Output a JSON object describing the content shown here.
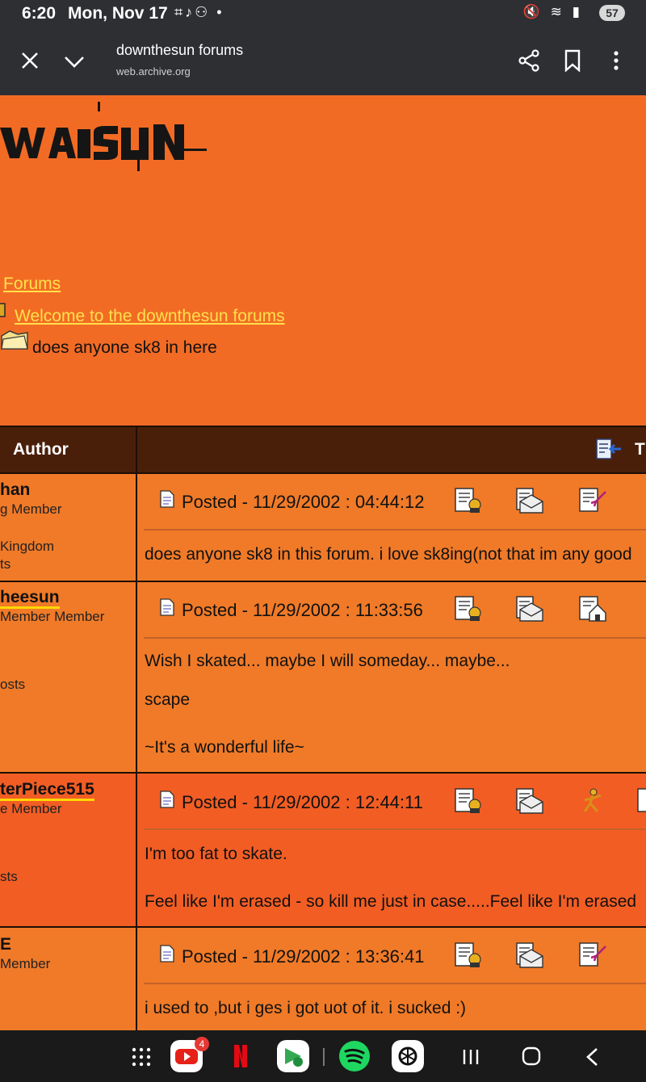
{
  "status_bar": {
    "time": "6:20",
    "date": "Mon, Nov 17",
    "left_icons": "⌗♪⚇ •",
    "right_icons": "🔇 ≋ ▮",
    "battery": "57"
  },
  "toolbar": {
    "page_title": "downthesun forums",
    "url": "web.archive.org"
  },
  "breadcrumbs": {
    "root": "Forums",
    "forum": "Welcome to the downthesun forums",
    "topic": "does anyone sk8 in here"
  },
  "table": {
    "author_header": "Author",
    "topic_header_char": "T"
  },
  "posts": [
    {
      "author": "han",
      "rank": "g Member",
      "location": "Kingdom",
      "posts": "ts",
      "posted": "Posted - 11/29/2002 :  04:44:12",
      "message": "does anyone sk8 in this forum. i love sk8ing(not that im any good"
    },
    {
      "author": "heesun",
      "rank": "Member Member",
      "posts": "osts",
      "posted": "Posted - 11/29/2002 :  11:33:56",
      "message": "Wish I skated... maybe I will someday... maybe...",
      "sig1": "scape",
      "sig2": "~It's a wonderful life~"
    },
    {
      "author": "terPiece515",
      "rank": "e Member",
      "posts": "sts",
      "posted": "Posted - 11/29/2002 :  12:44:11",
      "message": "I'm too fat to skate.",
      "sig1": "Feel like I'm erased - so kill me just in case.....Feel like I'm erased"
    },
    {
      "author": "E",
      "rank": "Member",
      "posted": "Posted - 11/29/2002 :  13:36:41",
      "message": "i used to ,but i ges i got uot of it. i sucked :)"
    }
  ],
  "navbar": {
    "youtube_badge": "4"
  },
  "colors": {
    "page_bg": "#f26b25",
    "link": "#ffe14a",
    "header_bg": "#4a1f0a",
    "chrome_bg": "#2d2f33"
  }
}
